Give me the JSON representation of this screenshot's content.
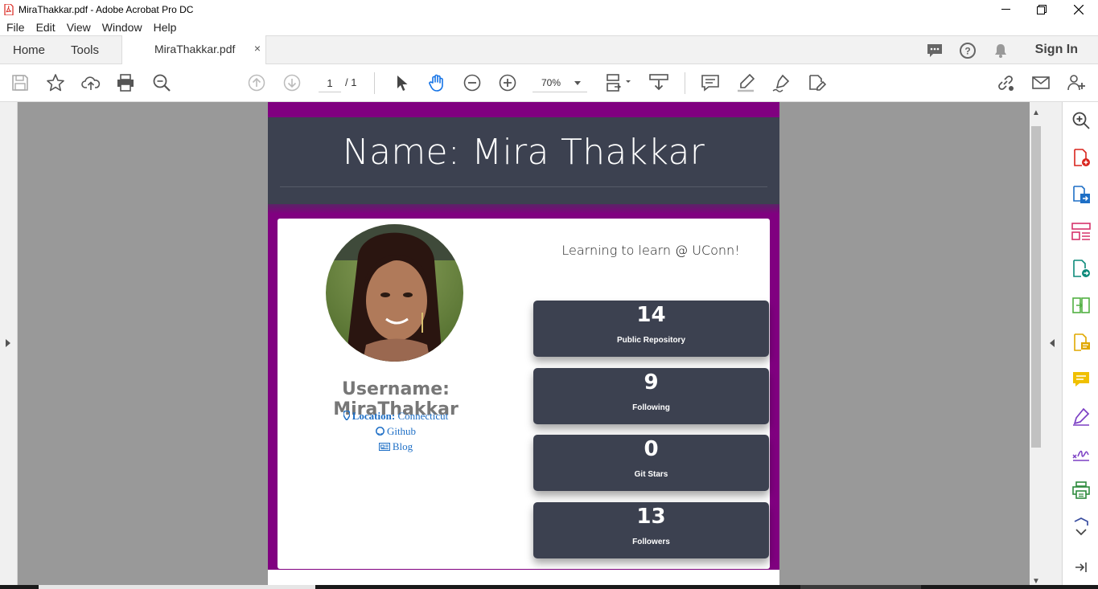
{
  "window": {
    "title": "MiraThakkar.pdf - Adobe Acrobat Pro DC"
  },
  "menubar": {
    "items": [
      "File",
      "Edit",
      "View",
      "Window",
      "Help"
    ]
  },
  "tabs": {
    "home": "Home",
    "tools": "Tools",
    "document": "MiraThakkar.pdf",
    "close": "×",
    "sign_in": "Sign In"
  },
  "toolbar": {
    "page_current": "1",
    "page_total": "/ 1",
    "zoom": "70%"
  },
  "document": {
    "name_heading": "Name: Mira Thakkar",
    "bio": "Learning to learn @ UConn!",
    "username": "Username: MiraThakkar",
    "location_label": "Location:",
    "location_value": "Connecticut",
    "github_link": "Github",
    "blog_link": "Blog",
    "stats": [
      {
        "value": "14",
        "label": "Public Repository"
      },
      {
        "value": "9",
        "label": "Following"
      },
      {
        "value": "0",
        "label": "Git Stars"
      },
      {
        "value": "13",
        "label": "Followers"
      }
    ]
  },
  "colors": {
    "page_purple": "#800080",
    "header_slate": "#3c4150",
    "link_blue": "#1e6fc6"
  }
}
